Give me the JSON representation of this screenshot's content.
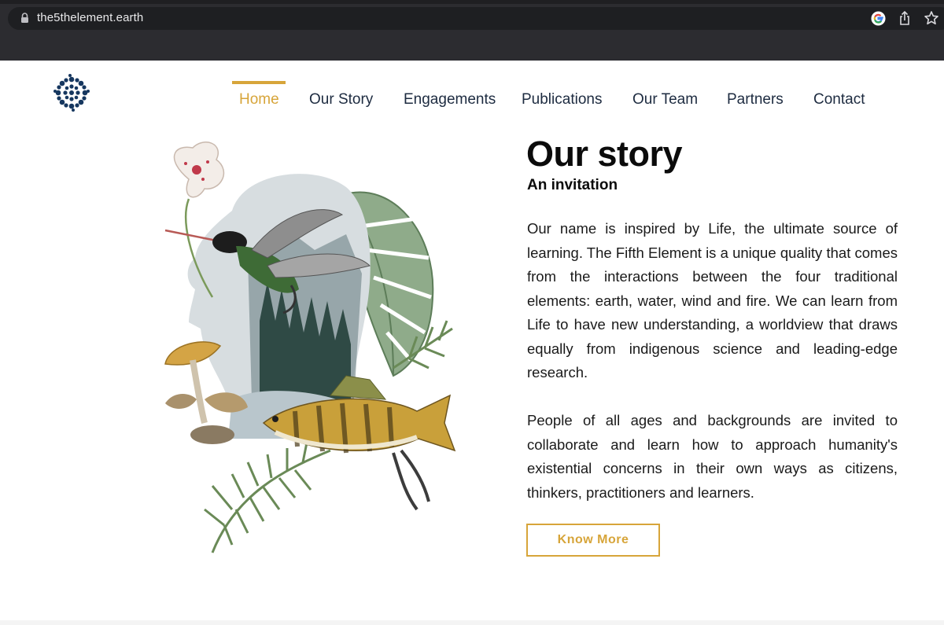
{
  "browser": {
    "url": "the5thelement.earth",
    "icons": [
      "lock-icon",
      "google-icon",
      "share-icon",
      "star-icon"
    ]
  },
  "site": {
    "logo": "mandala-logo-icon",
    "nav": [
      {
        "label": "Home",
        "active": true
      },
      {
        "label": "Our Story",
        "active": false
      },
      {
        "label": "Engagements",
        "active": false
      },
      {
        "label": "Publications",
        "active": false
      },
      {
        "label": "Our Team",
        "active": false
      },
      {
        "label": "Partners",
        "active": false
      },
      {
        "label": "Contact",
        "active": false
      }
    ]
  },
  "content": {
    "title": "Our story",
    "subtitle": "An invitation",
    "paragraph1": "Our name is inspired by Life, the ultimate source of learning. The Fifth Element is a unique quality that comes from the interactions between the four traditional elements: earth, water, wind and fire. We can learn from Life to have new understanding, a worldview that draws equally from indigenous science and leading-edge research.",
    "paragraph2": "People of all ages and backgrounds are invited to collaborate and learn how to approach humanity's existential concerns in their own ways as citizens, thinkers, practitioners and learners.",
    "button": "Know More"
  },
  "colors": {
    "accent": "#d7a53a",
    "nav_text": "#1d2b40",
    "logo": "#16375f",
    "chrome": "#2c2c30"
  }
}
